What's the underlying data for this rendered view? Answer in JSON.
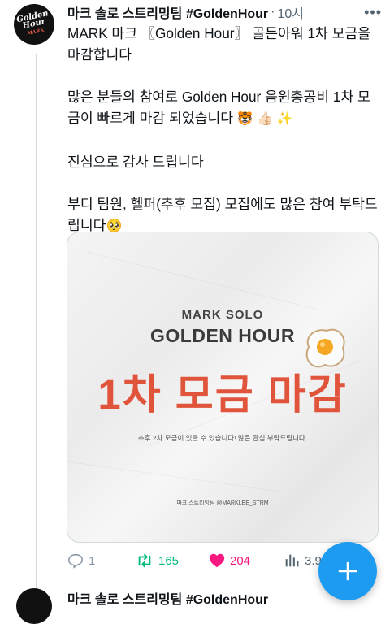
{
  "tweet": {
    "author": "마크 솔로 스트리밍팀 #GoldenHour",
    "separator": "·",
    "time": "10시",
    "avatar_text": "Golden Hour",
    "avatar_sub": "MARK",
    "line1": "MARK 마크 〖Golden Hour〗 골든아워 1차 모금을 마감합니다",
    "line2": "많은 분들의 참여로 Golden Hour 음원총공비 1차 모금이 빠르게 마감 되었습니다",
    "line2_emoji": "🐯 👍🏻 ✨",
    "line3": "진심으로 감사 드립니다",
    "line4": "부디 팀원, 헬퍼(추후 모집) 모집에도 많은 참여 부탁드립니다",
    "line4_emoji": "🥺"
  },
  "media": {
    "title_small": "MARK SOLO",
    "title_big": "GOLDEN HOUR",
    "headline": "1차 모금 마감",
    "subtext": "추후 2차 모금이 있을 수 있습니다! 많은 관심 부탁드립니다.",
    "credit": "마크 스트리밍팀 @MARKLEE_STRM"
  },
  "actions": {
    "reply_count": "1",
    "retweet_count": "165",
    "like_count": "204",
    "views_count": "3.9",
    "reply_color": "#8b98a5",
    "retweet_color": "#00ba7c",
    "like_color": "#f91880"
  },
  "next_tweet": {
    "author": "마크 솔로 스트리밍팀 #GoldenHour"
  },
  "colors": {
    "accent": "#1d9bf0",
    "headline_red": "#e1543c"
  }
}
